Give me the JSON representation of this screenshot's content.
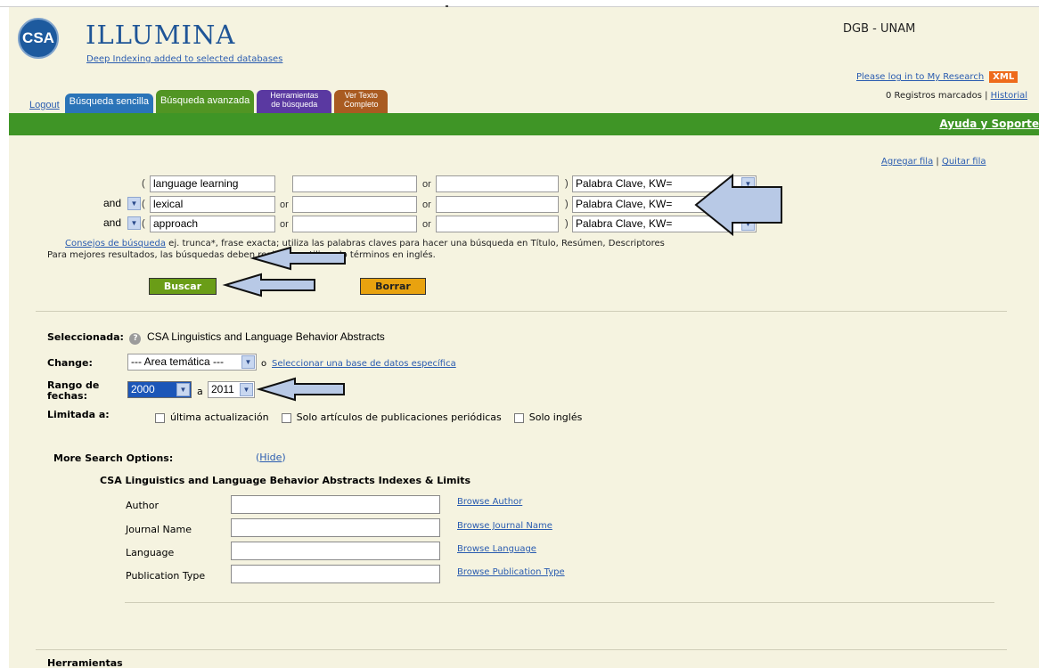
{
  "header": {
    "logo_text": "CSA",
    "brand": "ILLUMINA",
    "tagline": "Deep Indexing added to selected databases",
    "institution": "DGB - UNAM",
    "login_link": "Please log in to My Research",
    "xml_badge": "XML",
    "records_text": "0 Registros marcados |",
    "history_link": "Historial"
  },
  "tabs": [
    {
      "label": "Logout"
    },
    {
      "label": "Búsqueda sencilla"
    },
    {
      "label": "Búsqueda avanzada"
    },
    {
      "label": "Herramientas de búsqueda"
    },
    {
      "label": "Ver Texto Completo"
    }
  ],
  "greenbar": {
    "help_link": "Ayuda y Soporte"
  },
  "rows_links": {
    "add": "Agregar fila",
    "sep": "|",
    "remove": "Quitar fila"
  },
  "search_rows": [
    {
      "op": "",
      "term1": "language learning",
      "term2": "",
      "term3": "",
      "field": "Palabra Clave, KW="
    },
    {
      "op": "and",
      "term1": "lexical",
      "term2": "",
      "term3": "",
      "field": "Palabra Clave, KW="
    },
    {
      "op": "and",
      "term1": "approach",
      "term2": "",
      "term3": "",
      "field": "Palabra Clave, KW="
    }
  ],
  "or_label": "or",
  "paren_open": "(",
  "paren_close": ")",
  "tips": {
    "link": "Consejos de búsqueda",
    "text": " ej. trunca*, frase exacta; utiliza las palabras claves para hacer una búsqueda en Título, Resúmen, Descriptores",
    "line2": "Para mejores resultados, las búsquedas deben realizarse utilizando términos en inglés."
  },
  "buttons": {
    "search": "Buscar",
    "clear": "Borrar"
  },
  "selected": {
    "label": "Seleccionada:",
    "db": "CSA Linguistics and Language Behavior Abstracts",
    "help_icon": "?"
  },
  "change": {
    "label": "Change:",
    "select": "--- Area temática ---",
    "or": "o",
    "link": "Seleccionar una base de datos específica"
  },
  "dates": {
    "label": "Rango de fechas:",
    "from": "2000",
    "sep": "a",
    "to": "2011"
  },
  "limits": {
    "label": "Limitada a:",
    "options": [
      "última actualización",
      "Solo artículos de publicaciones periódicas",
      "Solo inglés"
    ]
  },
  "more": {
    "label": "More Search Options:",
    "hide_pre": "(",
    "hide": "Hide",
    "hide_post": ")"
  },
  "indexes": {
    "title": "CSA Linguistics and Language Behavior Abstracts Indexes & Limits",
    "rows": [
      {
        "label": "Author",
        "browse": "Browse Author"
      },
      {
        "label": "Journal Name",
        "browse": "Browse Journal Name"
      },
      {
        "label": "Language",
        "browse": "Browse Language"
      },
      {
        "label": "Publication Type",
        "browse": "Browse Publication Type"
      }
    ]
  },
  "footer_label": "Herramientas"
}
